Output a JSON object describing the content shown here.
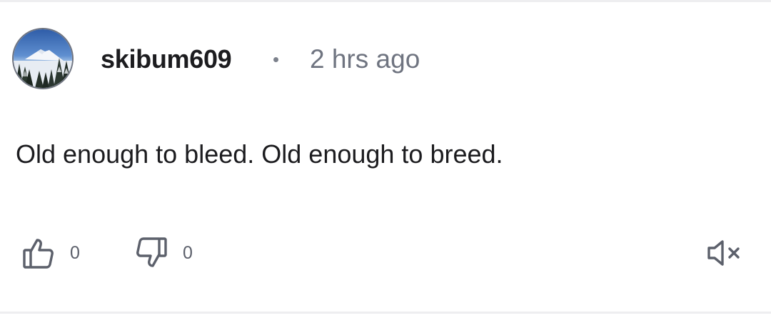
{
  "comment": {
    "username": "skibum609",
    "separator_icon": "dot-separator",
    "timestamp": "2 hrs ago",
    "text": "Old enough to bleed. Old enough to breed.",
    "avatar": "mountain-landscape-avatar"
  },
  "actions": {
    "like_icon": "thumbs-up-icon",
    "like_count": "0",
    "dislike_icon": "thumbs-down-icon",
    "dislike_count": "0",
    "mute_icon": "speaker-muted-icon"
  },
  "colors": {
    "text_primary": "#1c1c1f",
    "text_secondary": "#6f7480",
    "icon": "#5c606b",
    "divider": "#eeeef0"
  }
}
